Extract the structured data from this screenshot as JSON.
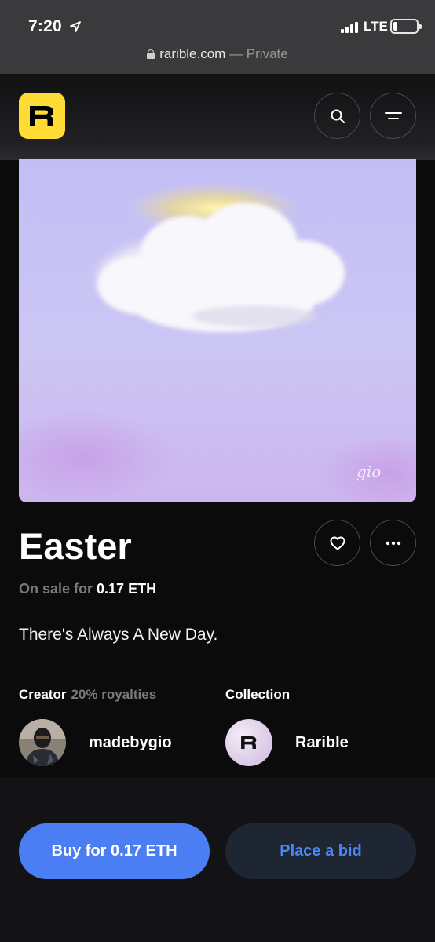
{
  "status_bar": {
    "time": "7:20",
    "network": "LTE",
    "battery_level": 0.15
  },
  "browser": {
    "domain": "rarible.com",
    "mode": " — Private"
  },
  "header": {
    "logo_letter": "R",
    "logo_color": "#fedc33",
    "search_icon": "search-icon",
    "menu_icon": "menu-icon"
  },
  "item": {
    "title": "Easter",
    "sale_prefix": "On sale for ",
    "price": "0.17 ETH",
    "description": "There's Always A New Day.",
    "signature": "gio"
  },
  "creator": {
    "label": "Creator",
    "royalties": "20% royalties",
    "name": "madebygio"
  },
  "collection": {
    "label": "Collection",
    "name": "Rarible"
  },
  "actions": {
    "buy_label": "Buy for 0.17 ETH",
    "bid_label": "Place a bid",
    "buy_color": "#4a7ef2",
    "bid_color": "#4a86f5"
  }
}
